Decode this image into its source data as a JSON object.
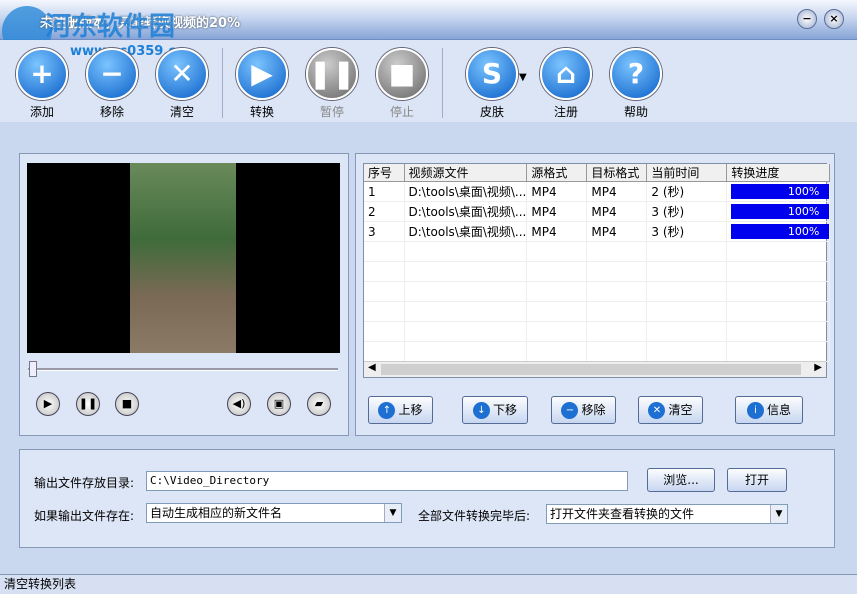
{
  "window": {
    "title": "未注册版本，只能转换视频的20%",
    "watermark": "河东软件园",
    "watermark_url": "www.pc0359.cn",
    "minimize": "−",
    "close": "×"
  },
  "toolbar": [
    {
      "label": "添加",
      "icon": "plus-icon",
      "glyph": "+"
    },
    {
      "label": "移除",
      "icon": "minus-icon",
      "glyph": "−"
    },
    {
      "label": "清空",
      "icon": "clear-icon",
      "glyph": "✕"
    },
    {
      "label": "转换",
      "icon": "play-icon",
      "glyph": "▶"
    },
    {
      "label": "暂停",
      "icon": "pause-icon",
      "glyph": "❚❚"
    },
    {
      "label": "停止",
      "icon": "stop-icon",
      "glyph": "■"
    },
    {
      "label": "皮肤",
      "icon": "skin-icon",
      "glyph": "S"
    },
    {
      "label": "注册",
      "icon": "home-icon",
      "glyph": "⌂"
    },
    {
      "label": "帮助",
      "icon": "help-icon",
      "glyph": "?"
    }
  ],
  "player": {
    "play": "▶",
    "pause": "❚❚",
    "stop": "■",
    "volume": "◀)",
    "snapshot": "▣",
    "folder": "▰"
  },
  "table": {
    "columns": [
      "序号",
      "视频源文件",
      "源格式",
      "目标格式",
      "当前时间",
      "转换进度"
    ],
    "rows": [
      [
        "1",
        "D:\\tools\\桌面\\视频\\...",
        "MP4",
        "MP4",
        "2 (秒)",
        "100%"
      ],
      [
        "2",
        "D:\\tools\\桌面\\视频\\...",
        "MP4",
        "MP4",
        "3 (秒)",
        "100%"
      ],
      [
        "3",
        "D:\\tools\\桌面\\视频\\...",
        "MP4",
        "MP4",
        "3 (秒)",
        "100%"
      ]
    ],
    "progress": [
      100,
      100,
      100
    ]
  },
  "list_buttons": [
    {
      "label": "上移",
      "glyph": "↑"
    },
    {
      "label": "下移",
      "glyph": "↓"
    },
    {
      "label": "移除",
      "glyph": "−"
    },
    {
      "label": "清空",
      "glyph": "✕"
    },
    {
      "label": "信息",
      "glyph": "i"
    }
  ],
  "output": {
    "dir_label": "输出文件存放目录:",
    "dir_value": "C:\\Video_Directory",
    "browse": "浏览...",
    "open": "打开",
    "exists_label": "如果输出文件存在:",
    "exists_value": "自动生成相应的新文件名",
    "after_label": "全部文件转换完毕后:",
    "after_value": "打开文件夹查看转换的文件"
  },
  "status": "清空转换列表"
}
